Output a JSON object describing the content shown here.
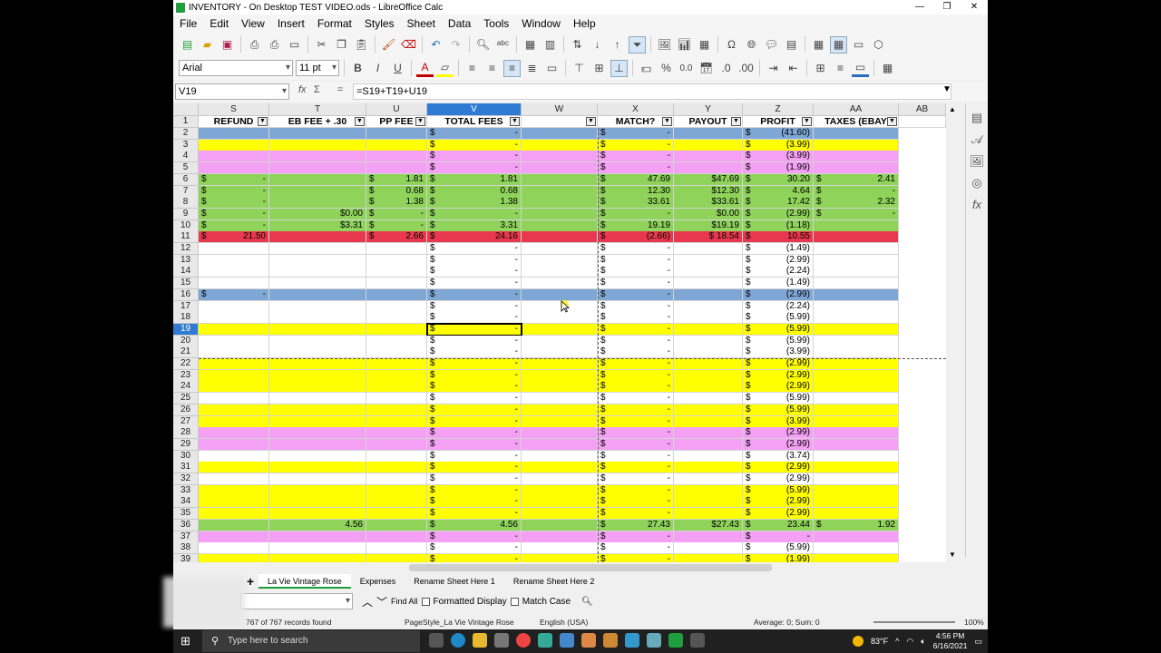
{
  "window": {
    "title": "INVENTORY - On Desktop TEST VIDEO.ods - LibreOffice Calc",
    "minimize": "—",
    "maximize": "❐",
    "close": "✕"
  },
  "menu": [
    "File",
    "Edit",
    "View",
    "Insert",
    "Format",
    "Styles",
    "Sheet",
    "Data",
    "Tools",
    "Window",
    "Help"
  ],
  "format_toolbar": {
    "font_name": "Arial",
    "font_size": "11 pt",
    "bold": "B",
    "italic": "I",
    "underline": "U",
    "percent": "%",
    "decimal": "0.0"
  },
  "formula_bar": {
    "name_box": "V19",
    "fx": "fx",
    "sum": "Σ",
    "equals": "=",
    "formula": "=S19+T19+U19"
  },
  "columns": [
    {
      "id": "S",
      "header": "REFUND"
    },
    {
      "id": "T",
      "header": "EB FEE + .30"
    },
    {
      "id": "U",
      "header": "PP FEE"
    },
    {
      "id": "V",
      "header": "TOTAL FEES"
    },
    {
      "id": "W",
      "header": ""
    },
    {
      "id": "X",
      "header": "MATCH?"
    },
    {
      "id": "Y",
      "header": "PAYOUT"
    },
    {
      "id": "Z",
      "header": "PROFIT"
    },
    {
      "id": "AA",
      "header": "TAXES (EBAY"
    },
    {
      "id": "AB",
      "header": ""
    }
  ],
  "colors": {
    "blue": "#7fa7d6",
    "yellow": "#ffff00",
    "pink": "#f4a0f4",
    "green": "#8fd35b",
    "red": "#e8384f",
    "white": "#ffffff",
    "selection": "#2f7bd3"
  },
  "rows": [
    {
      "n": "2",
      "c": "blue",
      "S": [
        "",
        ""
      ],
      "T": "",
      "U": [
        "",
        ""
      ],
      "V": [
        "$",
        "-"
      ],
      "X": [
        "$",
        "-"
      ],
      "Y": "",
      "Z": [
        "$",
        "(41.60)"
      ],
      "AA": [
        "",
        ""
      ]
    },
    {
      "n": "3",
      "c": "yellow",
      "S": [
        "",
        ""
      ],
      "T": "",
      "U": [
        "",
        ""
      ],
      "V": [
        "$",
        "-"
      ],
      "X": [
        "$",
        "-"
      ],
      "Y": "",
      "Z": [
        "$",
        "(3.99)"
      ],
      "AA": [
        "",
        ""
      ]
    },
    {
      "n": "4",
      "c": "pink",
      "S": [
        "",
        ""
      ],
      "T": "",
      "U": [
        "",
        ""
      ],
      "V": [
        "$",
        "-"
      ],
      "X": [
        "$",
        "-"
      ],
      "Y": "",
      "Z": [
        "$",
        "(3.99)"
      ],
      "AA": [
        "",
        ""
      ]
    },
    {
      "n": "5",
      "c": "pink",
      "S": [
        "",
        ""
      ],
      "T": "",
      "U": [
        "",
        ""
      ],
      "V": [
        "$",
        "-"
      ],
      "X": [
        "$",
        "-"
      ],
      "Y": "",
      "Z": [
        "$",
        "(1.99)"
      ],
      "AA": [
        "",
        ""
      ]
    },
    {
      "n": "6",
      "c": "green",
      "S": [
        "$",
        "-"
      ],
      "T": "",
      "U": [
        "$",
        "1.81"
      ],
      "V": [
        "$",
        "1.81"
      ],
      "X": [
        "$",
        "47.69"
      ],
      "Y": "$47.69",
      "Z": [
        "$",
        "30.20"
      ],
      "AA": [
        "$",
        "2.41"
      ]
    },
    {
      "n": "7",
      "c": "green",
      "S": [
        "$",
        "-"
      ],
      "T": "",
      "U": [
        "$",
        "0.68"
      ],
      "V": [
        "$",
        "0.68"
      ],
      "X": [
        "$",
        "12.30"
      ],
      "Y": "$12.30",
      "Z": [
        "$",
        "4.64"
      ],
      "AA": [
        "$",
        "-"
      ]
    },
    {
      "n": "8",
      "c": "green",
      "S": [
        "$",
        "-"
      ],
      "T": "",
      "U": [
        "$",
        "1.38"
      ],
      "V": [
        "$",
        "1.38"
      ],
      "X": [
        "$",
        "33.61"
      ],
      "Y": "$33.61",
      "Z": [
        "$",
        "17.42"
      ],
      "AA": [
        "$",
        "2.32"
      ]
    },
    {
      "n": "9",
      "c": "green",
      "S": [
        "$",
        "-"
      ],
      "T": "$0.00",
      "U": [
        "$",
        "-"
      ],
      "V": [
        "$",
        "-"
      ],
      "X": [
        "$",
        "-"
      ],
      "Y": "$0.00",
      "Z": [
        "$",
        "(2.99)"
      ],
      "AA": [
        "$",
        "-"
      ]
    },
    {
      "n": "10",
      "c": "green",
      "S": [
        "$",
        "-"
      ],
      "T": "$3.31",
      "U": [
        "$",
        "-"
      ],
      "V": [
        "$",
        "3.31"
      ],
      "X": [
        "$",
        "19.19"
      ],
      "Y": "$19.19",
      "Z": [
        "$",
        "(1.18)"
      ],
      "AA": [
        "",
        ""
      ]
    },
    {
      "n": "11",
      "c": "red",
      "S": [
        "$",
        "21.50"
      ],
      "T": "",
      "U": [
        "$",
        "2.66"
      ],
      "V": [
        "$",
        "24.16"
      ],
      "X": [
        "$",
        "(2.66)"
      ],
      "Y": "$ 18.54",
      "Z": [
        "$",
        "10.55"
      ],
      "AA": [
        "",
        ""
      ]
    },
    {
      "n": "12",
      "c": "white",
      "S": [
        "",
        ""
      ],
      "T": "",
      "U": [
        "",
        ""
      ],
      "V": [
        "$",
        "-"
      ],
      "X": [
        "$",
        "-"
      ],
      "Y": "",
      "Z": [
        "$",
        "(1.49)"
      ],
      "AA": [
        "",
        ""
      ]
    },
    {
      "n": "13",
      "c": "white",
      "S": [
        "",
        ""
      ],
      "T": "",
      "U": [
        "",
        ""
      ],
      "V": [
        "$",
        "-"
      ],
      "X": [
        "$",
        "-"
      ],
      "Y": "",
      "Z": [
        "$",
        "(2.99)"
      ],
      "AA": [
        "",
        ""
      ]
    },
    {
      "n": "14",
      "c": "white",
      "S": [
        "",
        ""
      ],
      "T": "",
      "U": [
        "",
        ""
      ],
      "V": [
        "$",
        "-"
      ],
      "X": [
        "$",
        "-"
      ],
      "Y": "",
      "Z": [
        "$",
        "(2.24)"
      ],
      "AA": [
        "",
        ""
      ]
    },
    {
      "n": "15",
      "c": "white",
      "S": [
        "",
        ""
      ],
      "T": "",
      "U": [
        "",
        ""
      ],
      "V": [
        "$",
        "-"
      ],
      "X": [
        "$",
        "-"
      ],
      "Y": "",
      "Z": [
        "$",
        "(1.49)"
      ],
      "AA": [
        "",
        ""
      ]
    },
    {
      "n": "16",
      "c": "blue",
      "S": [
        "$",
        "-"
      ],
      "T": "",
      "U": [
        "",
        ""
      ],
      "V": [
        "$",
        "-"
      ],
      "X": [
        "$",
        "-"
      ],
      "Y": "",
      "Z": [
        "$",
        "(2.99)"
      ],
      "AA": [
        "",
        ""
      ]
    },
    {
      "n": "17",
      "c": "white",
      "S": [
        "",
        ""
      ],
      "T": "",
      "U": [
        "",
        ""
      ],
      "V": [
        "$",
        "-"
      ],
      "X": [
        "$",
        "-"
      ],
      "Y": "",
      "Z": [
        "$",
        "(2.24)"
      ],
      "AA": [
        "",
        ""
      ]
    },
    {
      "n": "18",
      "c": "white",
      "S": [
        "",
        ""
      ],
      "T": "",
      "U": [
        "",
        ""
      ],
      "V": [
        "$",
        "-"
      ],
      "X": [
        "$",
        "-"
      ],
      "Y": "",
      "Z": [
        "$",
        "(5.99)"
      ],
      "AA": [
        "",
        ""
      ]
    },
    {
      "n": "19",
      "c": "yellow",
      "S": [
        "",
        ""
      ],
      "T": "",
      "U": [
        "",
        ""
      ],
      "V": [
        "$",
        "-"
      ],
      "X": [
        "$",
        "-"
      ],
      "Y": "",
      "Z": [
        "$",
        "(5.99)"
      ],
      "AA": [
        "",
        ""
      ]
    },
    {
      "n": "20",
      "c": "white",
      "S": [
        "",
        ""
      ],
      "T": "",
      "U": [
        "",
        ""
      ],
      "V": [
        "$",
        "-"
      ],
      "X": [
        "$",
        "-"
      ],
      "Y": "",
      "Z": [
        "$",
        "(5.99)"
      ],
      "AA": [
        "",
        ""
      ]
    },
    {
      "n": "21",
      "c": "white",
      "S": [
        "",
        ""
      ],
      "T": "",
      "U": [
        "",
        ""
      ],
      "V": [
        "$",
        "-"
      ],
      "X": [
        "$",
        "-"
      ],
      "Y": "",
      "Z": [
        "$",
        "(3.99)"
      ],
      "AA": [
        "",
        ""
      ]
    },
    {
      "n": "22",
      "c": "yellow",
      "S": [
        "",
        ""
      ],
      "T": "",
      "U": [
        "",
        ""
      ],
      "V": [
        "$",
        "-"
      ],
      "X": [
        "$",
        "-"
      ],
      "Y": "",
      "Z": [
        "$",
        "(2.99)"
      ],
      "AA": [
        "",
        ""
      ]
    },
    {
      "n": "23",
      "c": "yellow",
      "S": [
        "",
        ""
      ],
      "T": "",
      "U": [
        "",
        ""
      ],
      "V": [
        "$",
        "-"
      ],
      "X": [
        "$",
        "-"
      ],
      "Y": "",
      "Z": [
        "$",
        "(2.99)"
      ],
      "AA": [
        "",
        ""
      ]
    },
    {
      "n": "24",
      "c": "yellow",
      "S": [
        "",
        ""
      ],
      "T": "",
      "U": [
        "",
        ""
      ],
      "V": [
        "$",
        "-"
      ],
      "X": [
        "$",
        "-"
      ],
      "Y": "",
      "Z": [
        "$",
        "(2.99)"
      ],
      "AA": [
        "",
        ""
      ]
    },
    {
      "n": "25",
      "c": "white",
      "S": [
        "",
        ""
      ],
      "T": "",
      "U": [
        "",
        ""
      ],
      "V": [
        "$",
        "-"
      ],
      "X": [
        "$",
        "-"
      ],
      "Y": "",
      "Z": [
        "$",
        "(5.99)"
      ],
      "AA": [
        "",
        ""
      ]
    },
    {
      "n": "26",
      "c": "yellow",
      "S": [
        "",
        ""
      ],
      "T": "",
      "U": [
        "",
        ""
      ],
      "V": [
        "$",
        "-"
      ],
      "X": [
        "$",
        "-"
      ],
      "Y": "",
      "Z": [
        "$",
        "(5.99)"
      ],
      "AA": [
        "",
        ""
      ]
    },
    {
      "n": "27",
      "c": "yellow",
      "S": [
        "",
        ""
      ],
      "T": "",
      "U": [
        "",
        ""
      ],
      "V": [
        "$",
        "-"
      ],
      "X": [
        "$",
        "-"
      ],
      "Y": "",
      "Z": [
        "$",
        "(3.99)"
      ],
      "AA": [
        "",
        ""
      ]
    },
    {
      "n": "28",
      "c": "pink",
      "S": [
        "",
        ""
      ],
      "T": "",
      "U": [
        "",
        ""
      ],
      "V": [
        "$",
        "-"
      ],
      "X": [
        "$",
        "-"
      ],
      "Y": "",
      "Z": [
        "$",
        "(2.99)"
      ],
      "AA": [
        "",
        ""
      ]
    },
    {
      "n": "29",
      "c": "pink",
      "S": [
        "",
        ""
      ],
      "T": "",
      "U": [
        "",
        ""
      ],
      "V": [
        "$",
        "-"
      ],
      "X": [
        "$",
        "-"
      ],
      "Y": "",
      "Z": [
        "$",
        "(2.99)"
      ],
      "AA": [
        "",
        ""
      ]
    },
    {
      "n": "30",
      "c": "white",
      "S": [
        "",
        ""
      ],
      "T": "",
      "U": [
        "",
        ""
      ],
      "V": [
        "$",
        "-"
      ],
      "X": [
        "$",
        "-"
      ],
      "Y": "",
      "Z": [
        "$",
        "(3.74)"
      ],
      "AA": [
        "",
        ""
      ]
    },
    {
      "n": "31",
      "c": "yellow",
      "S": [
        "",
        ""
      ],
      "T": "",
      "U": [
        "",
        ""
      ],
      "V": [
        "$",
        "-"
      ],
      "X": [
        "$",
        "-"
      ],
      "Y": "",
      "Z": [
        "$",
        "(2.99)"
      ],
      "AA": [
        "",
        ""
      ]
    },
    {
      "n": "32",
      "c": "white",
      "S": [
        "",
        ""
      ],
      "T": "",
      "U": [
        "",
        ""
      ],
      "V": [
        "$",
        "-"
      ],
      "X": [
        "$",
        "-"
      ],
      "Y": "",
      "Z": [
        "$",
        "(2.99)"
      ],
      "AA": [
        "",
        ""
      ]
    },
    {
      "n": "33",
      "c": "yellow",
      "S": [
        "",
        ""
      ],
      "T": "",
      "U": [
        "",
        ""
      ],
      "V": [
        "$",
        "-"
      ],
      "X": [
        "$",
        "-"
      ],
      "Y": "",
      "Z": [
        "$",
        "(5.99)"
      ],
      "AA": [
        "",
        ""
      ]
    },
    {
      "n": "34",
      "c": "yellow",
      "S": [
        "",
        ""
      ],
      "T": "",
      "U": [
        "",
        ""
      ],
      "V": [
        "$",
        "-"
      ],
      "X": [
        "$",
        "-"
      ],
      "Y": "",
      "Z": [
        "$",
        "(2.99)"
      ],
      "AA": [
        "",
        ""
      ]
    },
    {
      "n": "35",
      "c": "yellow",
      "S": [
        "",
        ""
      ],
      "T": "",
      "U": [
        "",
        ""
      ],
      "V": [
        "$",
        "-"
      ],
      "X": [
        "$",
        "-"
      ],
      "Y": "",
      "Z": [
        "$",
        "(2.99)"
      ],
      "AA": [
        "",
        ""
      ]
    },
    {
      "n": "36",
      "c": "green",
      "S": [
        "",
        ""
      ],
      "T": "4.56",
      "U": [
        "",
        ""
      ],
      "V": [
        "$",
        "4.56"
      ],
      "X": [
        "$",
        "27.43"
      ],
      "Y": "$27.43",
      "Z": [
        "$",
        "23.44"
      ],
      "AA": [
        "$",
        "1.92"
      ]
    },
    {
      "n": "37",
      "c": "pink",
      "S": [
        "",
        ""
      ],
      "T": "",
      "U": [
        "",
        ""
      ],
      "V": [
        "$",
        "-"
      ],
      "X": [
        "$",
        "-"
      ],
      "Y": "",
      "Z": [
        "$",
        "-"
      ],
      "AA": [
        "",
        ""
      ]
    },
    {
      "n": "38",
      "c": "white",
      "S": [
        "",
        ""
      ],
      "T": "",
      "U": [
        "",
        ""
      ],
      "V": [
        "$",
        "-"
      ],
      "X": [
        "$",
        "-"
      ],
      "Y": "",
      "Z": [
        "$",
        "(5.99)"
      ],
      "AA": [
        "",
        ""
      ]
    },
    {
      "n": "39",
      "c": "yellow",
      "S": [
        "",
        ""
      ],
      "T": "",
      "U": [
        "",
        ""
      ],
      "V": [
        "$",
        "-"
      ],
      "X": [
        "$",
        "-"
      ],
      "Y": "",
      "Z": [
        "$",
        "(1.99)"
      ],
      "AA": [
        "",
        ""
      ]
    }
  ],
  "selected_row": "19",
  "selected_col": "V",
  "sheet_tabs": [
    "La Vie Vintage Rose",
    "Expenses",
    "Rename Sheet Here 1",
    "Rename Sheet Here 2"
  ],
  "active_tab": "La Vie Vintage Rose",
  "find_bar": {
    "find_all": "Find All",
    "formatted_display": "Formatted Display",
    "match_case": "Match Case"
  },
  "status_bar": {
    "records": "767 of 767 records found",
    "page_style": "PageStyle_La Vie Vintage Rose",
    "language": "English (USA)",
    "summary": "Average: 0; Sum: 0",
    "zoom": "100%"
  },
  "taskbar": {
    "search_placeholder": "Type here to search",
    "weather": "83°F",
    "time": "4:56 PM",
    "date": "6/16/2021"
  }
}
